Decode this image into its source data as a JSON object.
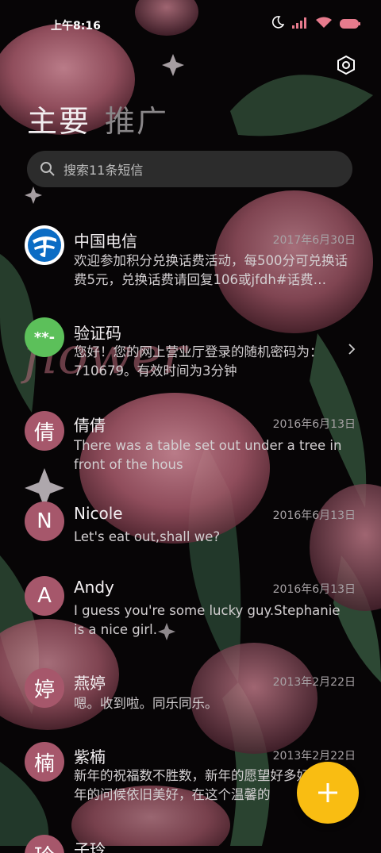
{
  "status_bar": {
    "time": "上午8:16"
  },
  "tabs": [
    {
      "label": "主要",
      "active": true
    },
    {
      "label": "推广",
      "active": false
    }
  ],
  "search": {
    "placeholder": "搜索11条短信"
  },
  "conversations": [
    {
      "name": "中国电信",
      "date": "2017年6月30日",
      "preview": "欢迎参加积分兑换话费活动，每500分可兑换话费5元，兑换话费请回复106或jfdh#话费…",
      "avatar": "logo"
    },
    {
      "name": "验证码",
      "date": "",
      "preview": "您好！您的网上营业厅登录的随机密码为：710679。有效时间为3分钟",
      "avatar": "**-",
      "avatar_color": "#5cc05a"
    },
    {
      "name": "倩倩",
      "date": "2016年6月13日",
      "preview": "There was a table set out under a tree in front of the hous",
      "avatar": "倩"
    },
    {
      "name": "Nicole",
      "date": "2016年6月13日",
      "preview": "Let's eat out,shall we?",
      "avatar": "N"
    },
    {
      "name": "Andy",
      "date": "2016年6月13日",
      "preview": "I guess you're some lucky guy.Stephanie is a nice girl.",
      "avatar": "A"
    },
    {
      "name": "燕婷",
      "date": "2013年2月22日",
      "preview": "嗯。收到啦。同乐同乐。",
      "avatar": "婷"
    },
    {
      "name": "紫楠",
      "date": "2013年2月22日",
      "preview": "新年的祝福数不胜数，新年的愿望好多好多，新年的问候依旧美好，在这个温馨的",
      "avatar": "楠"
    },
    {
      "name": "子玲",
      "date": "",
      "preview": "",
      "avatar": "玲"
    }
  ],
  "colors": {
    "avatar": "#a6576b",
    "accent_fab": "#f9bd12",
    "telecom_blue": "#0b6cc4"
  },
  "icons": [
    "moon-icon",
    "signal-icon",
    "wifi-icon",
    "battery-icon",
    "settings-icon",
    "search-icon",
    "chevron-right-icon",
    "plus-icon"
  ]
}
